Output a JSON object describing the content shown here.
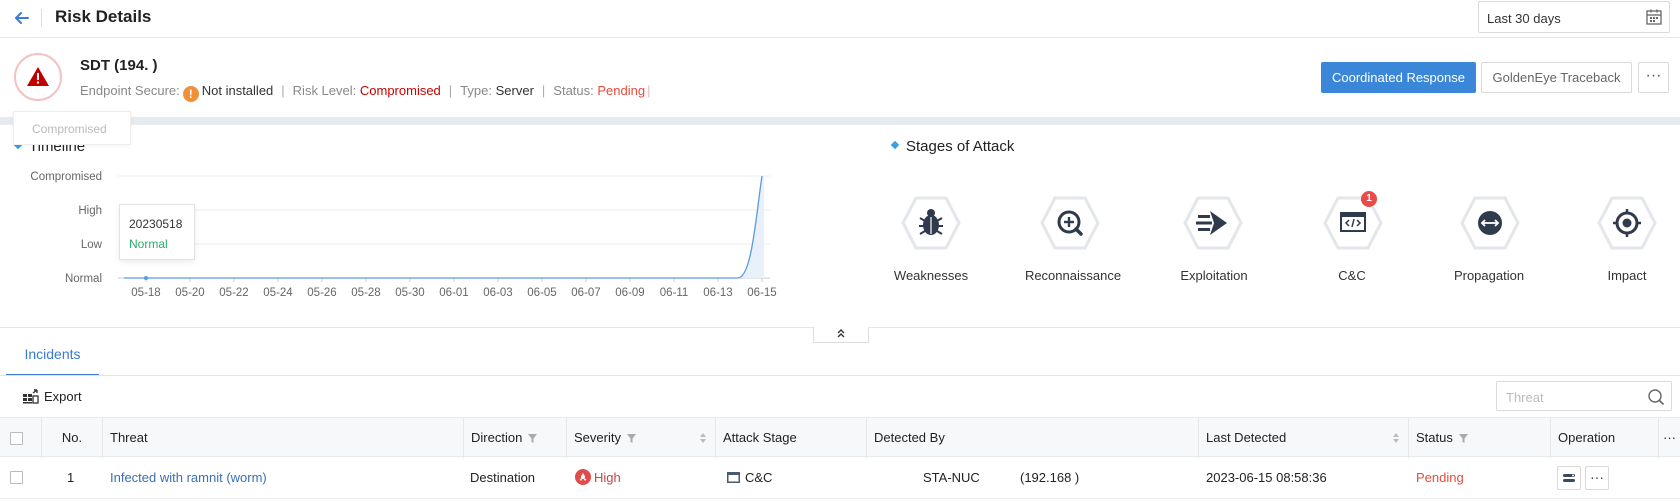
{
  "header": {
    "title": "Risk Details",
    "date_range": "Last 30 days"
  },
  "summary": {
    "host": "SDT (194.              )",
    "endpoint_label": "Endpoint Secure:",
    "endpoint_value": "Not installed",
    "risk_label": "Risk Level:",
    "risk_value": "Compromised",
    "type_label": "Type:",
    "type_value": "Server",
    "status_label": "Status:",
    "status_value": "Pending",
    "badge_tooltip": "Compromised",
    "colors": {
      "danger": "#c00000",
      "pending": "#e74c3c",
      "accent": "#3a87d9"
    }
  },
  "actions": {
    "coordinated": "Coordinated Response",
    "goldeneye": "GoldenEye Traceback",
    "more": "···"
  },
  "timeline": {
    "title": "Timeline",
    "y_levels": [
      "Compromised",
      "High",
      "Low",
      "Normal"
    ],
    "tooltip": {
      "date": "20230518",
      "level": "Normal"
    }
  },
  "chart_data": {
    "type": "line",
    "title": "Timeline",
    "x_ticks": [
      "05-18",
      "05-20",
      "05-22",
      "05-24",
      "05-26",
      "05-28",
      "05-30",
      "06-01",
      "06-03",
      "06-05",
      "06-07",
      "06-09",
      "06-11",
      "06-13",
      "06-15"
    ],
    "y_categories": [
      "Normal",
      "Low",
      "High",
      "Compromised"
    ],
    "series": [
      {
        "values": [
          {
            "x": "05-18",
            "y": "Normal"
          },
          {
            "x": "06-14",
            "y": "Normal"
          },
          {
            "x": "06-15",
            "y": "Compromised"
          }
        ]
      }
    ],
    "grid": true
  },
  "stages": {
    "title": "Stages of Attack",
    "items": [
      {
        "label": "Weaknesses",
        "icon": "bug-icon"
      },
      {
        "label": "Reconnaissance",
        "icon": "scan-icon"
      },
      {
        "label": "Exploitation",
        "icon": "exploit-icon"
      },
      {
        "label": "C&C",
        "icon": "code-window-icon",
        "badge": "1"
      },
      {
        "label": "Propagation",
        "icon": "spread-icon"
      },
      {
        "label": "Impact",
        "icon": "target-icon"
      }
    ]
  },
  "incidents": {
    "tab": "Incidents",
    "export": "Export",
    "search_placeholder": "Threat",
    "columns": [
      "No.",
      "Threat",
      "Direction",
      "Severity",
      "Attack Stage",
      "Detected By",
      "Last Detected",
      "Status",
      "Operation",
      "···"
    ],
    "rows": [
      {
        "no": "1",
        "threat": "Infected with ramnit (worm)",
        "direction": "Destination",
        "severity": "High",
        "stage": "C&C",
        "detected_by_a": "STA-NUC",
        "detected_by_b": "(192.168          )",
        "last_detected": "2023-06-15 08:58:36",
        "status": "Pending"
      }
    ]
  }
}
